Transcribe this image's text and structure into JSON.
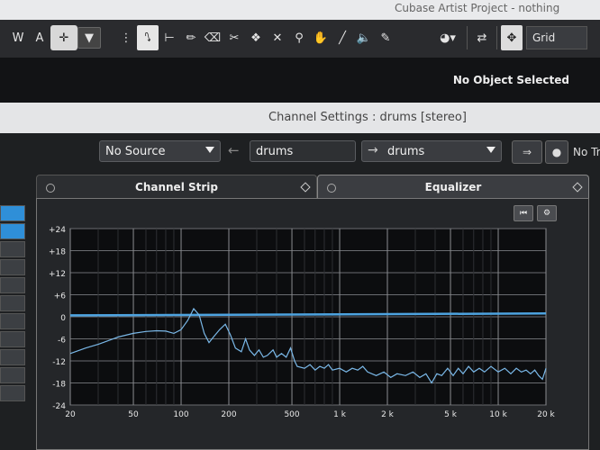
{
  "window_title": "Cubase Artist Project - nothing",
  "toolbar": {
    "w_label": "W",
    "a_label": "A",
    "grid_label": "Grid"
  },
  "info": {
    "no_object": "No Object Selected"
  },
  "channel_settings": {
    "title": "Channel Settings : drums [stereo]",
    "source_value": "No Source",
    "channel_name": "drums",
    "output_value": "drums",
    "truncated_label": "No Tr"
  },
  "tabs": {
    "channel_strip": "Channel Strip",
    "equalizer": "Equalizer"
  },
  "chart_data": {
    "type": "line",
    "x_scale": "log",
    "xlim": [
      20,
      20000
    ],
    "ylim": [
      -24,
      24
    ],
    "x_ticks": [
      {
        "v": 20,
        "label": "20"
      },
      {
        "v": 50,
        "label": "50"
      },
      {
        "v": 100,
        "label": "100"
      },
      {
        "v": 200,
        "label": "200"
      },
      {
        "v": 500,
        "label": "500"
      },
      {
        "v": 1000,
        "label": "1 k"
      },
      {
        "v": 2000,
        "label": "2 k"
      },
      {
        "v": 5000,
        "label": "5 k"
      },
      {
        "v": 10000,
        "label": "10 k"
      },
      {
        "v": 20000,
        "label": "20 k"
      }
    ],
    "y_ticks": [
      {
        "v": 24,
        "label": "+24"
      },
      {
        "v": 18,
        "label": "+18"
      },
      {
        "v": 12,
        "label": "+12"
      },
      {
        "v": 6,
        "label": "+6"
      },
      {
        "v": 0,
        "label": "0"
      },
      {
        "v": -6,
        "label": "-6"
      },
      {
        "v": -12,
        "label": "-12"
      },
      {
        "v": -18,
        "label": "-18"
      },
      {
        "v": -24,
        "label": "-24"
      }
    ],
    "series": [
      {
        "color": "#4da3e0",
        "points": [
          [
            20,
            0.4
          ],
          [
            20000,
            0.9
          ]
        ]
      },
      {
        "color": "#7ab8e8",
        "points": [
          [
            20,
            -10
          ],
          [
            25,
            -8.5
          ],
          [
            30,
            -7.5
          ],
          [
            40,
            -5.5
          ],
          [
            50,
            -4.5
          ],
          [
            60,
            -4
          ],
          [
            70,
            -3.8
          ],
          [
            80,
            -3.9
          ],
          [
            90,
            -4.5
          ],
          [
            100,
            -3.5
          ],
          [
            110,
            -1
          ],
          [
            120,
            2.2
          ],
          [
            130,
            0.5
          ],
          [
            140,
            -4.5
          ],
          [
            150,
            -7
          ],
          [
            160,
            -5.5
          ],
          [
            175,
            -3.5
          ],
          [
            190,
            -2
          ],
          [
            205,
            -5
          ],
          [
            220,
            -8.5
          ],
          [
            240,
            -9.5
          ],
          [
            255,
            -6
          ],
          [
            270,
            -9
          ],
          [
            290,
            -10.5
          ],
          [
            310,
            -9
          ],
          [
            330,
            -11
          ],
          [
            350,
            -10.5
          ],
          [
            380,
            -9
          ],
          [
            400,
            -11
          ],
          [
            430,
            -10
          ],
          [
            460,
            -11
          ],
          [
            490,
            -8.5
          ],
          [
            520,
            -12
          ],
          [
            540,
            -13.5
          ],
          [
            600,
            -14
          ],
          [
            650,
            -13
          ],
          [
            700,
            -14.5
          ],
          [
            750,
            -13.5
          ],
          [
            800,
            -14
          ],
          [
            850,
            -13
          ],
          [
            900,
            -14.5
          ],
          [
            1000,
            -14
          ],
          [
            1100,
            -15
          ],
          [
            1200,
            -14
          ],
          [
            1300,
            -14.5
          ],
          [
            1400,
            -13.5
          ],
          [
            1500,
            -15
          ],
          [
            1700,
            -16
          ],
          [
            1900,
            -15
          ],
          [
            2100,
            -16.5
          ],
          [
            2300,
            -15.5
          ],
          [
            2600,
            -16
          ],
          [
            2900,
            -15
          ],
          [
            3200,
            -16.5
          ],
          [
            3500,
            -15.5
          ],
          [
            3800,
            -18
          ],
          [
            4100,
            -15.5
          ],
          [
            4400,
            -16
          ],
          [
            4800,
            -14
          ],
          [
            5200,
            -16
          ],
          [
            5600,
            -14
          ],
          [
            6000,
            -15.5
          ],
          [
            6500,
            -13.5
          ],
          [
            7000,
            -15
          ],
          [
            7600,
            -14
          ],
          [
            8200,
            -15
          ],
          [
            9000,
            -13.5
          ],
          [
            10000,
            -15
          ],
          [
            11000,
            -14
          ],
          [
            12000,
            -15.5
          ],
          [
            13000,
            -14
          ],
          [
            14000,
            -15
          ],
          [
            15000,
            -14.5
          ],
          [
            16000,
            -15.5
          ],
          [
            17000,
            -14.5
          ],
          [
            18000,
            -16
          ],
          [
            19000,
            -17
          ],
          [
            20000,
            -14
          ]
        ]
      }
    ]
  }
}
